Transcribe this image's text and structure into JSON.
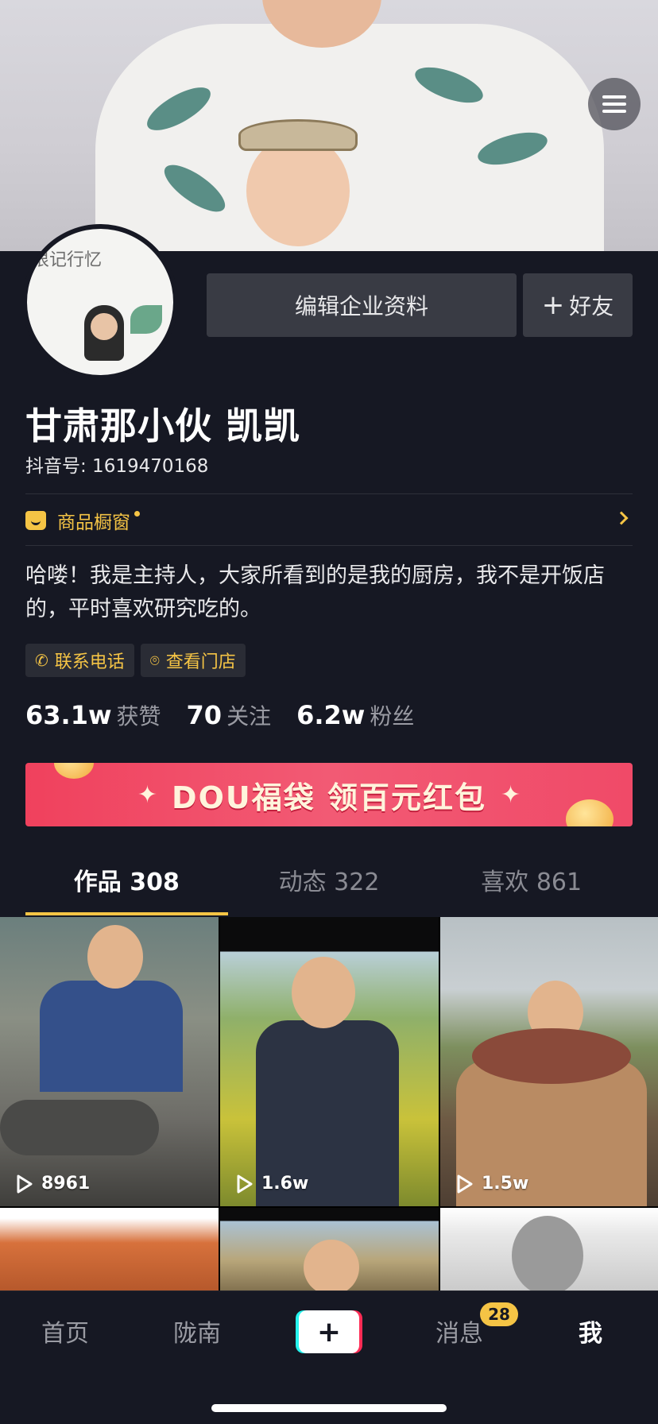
{
  "profile": {
    "edit_button": "编辑企业资料",
    "friend_button": "好友",
    "name": "甘肃那小伙 凯凯",
    "douyin_id": "抖音号: 1619470168",
    "shop_label": "商品橱窗",
    "bio": "哈喽！我是主持人，大家所看到的是我的厨房，我不是开饭店的，平时喜欢研究吃的。",
    "tags": [
      "联系电话",
      "查看门店"
    ],
    "stats": [
      {
        "value": "63.1w",
        "label": "获赞"
      },
      {
        "value": "70",
        "label": "关注"
      },
      {
        "value": "6.2w",
        "label": "粉丝"
      }
    ],
    "avatar_script": "很记行忆"
  },
  "banner": {
    "text": "DOU福袋  领百元红包"
  },
  "tabs": [
    {
      "label": "作品 308",
      "active": true
    },
    {
      "label": "动态 322",
      "active": false
    },
    {
      "label": "喜欢 861",
      "active": false
    }
  ],
  "videos": [
    {
      "views": "8961"
    },
    {
      "views": "1.6w"
    },
    {
      "views": "1.5w"
    }
  ],
  "bottom_nav": {
    "home": "首页",
    "region": "陇南",
    "create": "+",
    "messages": "消息",
    "messages_badge": "28",
    "me": "我"
  },
  "colors": {
    "accent": "#f5c445",
    "background": "#161823",
    "banner_red": "#f0415d"
  }
}
